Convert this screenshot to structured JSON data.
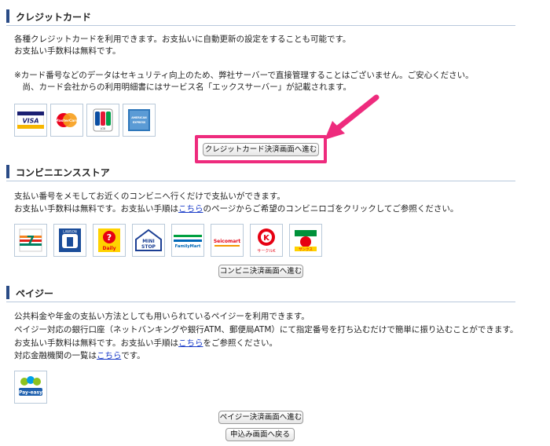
{
  "credit": {
    "heading": "クレジットカード",
    "lines": [
      "各種クレジットカードを利用できます。お支払いに自動更新の設定をすることも可能です。",
      "お支払い手数料は無料です。",
      "※カード番号などのデータはセキュリティ向上のため、弊社サーバーで直接管理することはございません。ご安心ください。",
      "　尚、カード会社からの利用明細書にはサービス名「エックスサーバー」が記載されます。"
    ],
    "logos": [
      "VISA",
      "MasterCard",
      "JCB",
      "AMERICAN EXPRESS"
    ],
    "button": "クレジットカード決済画面へ進む"
  },
  "convenience": {
    "heading": "コンビニエンスストア",
    "line1": "支払い番号をメモしてお近くのコンビニへ行くだけで支払いができます。",
    "line2_pre": "お支払い手数料は無料です。お支払い手順は",
    "line2_link": "こちら",
    "line2_post": "のページからご希望のコンビニロゴをクリックしてご参照ください。",
    "logos": [
      "7-ELEVEn",
      "LAWSON",
      "Daily",
      "MINI STOP",
      "FamilyMart",
      "Seicomart",
      "サークルK",
      "サンクス"
    ],
    "button": "コンビニ決済画面へ進む"
  },
  "payeasy": {
    "heading": "ペイジー",
    "line1": "公共料金や年金の支払い方法としても用いられているペイジーを利用できます。",
    "line2": "ペイジー対応の銀行口座（ネットバンキングや銀行ATM、郵便局ATM）にて指定番号を打ち込むだけで簡単に振り込むことができます。",
    "line3_pre": "お支払い手数料は無料です。お支払い手順は",
    "line3_link": "こちら",
    "line3_post": "をご参照ください。",
    "line4_pre": "対応金融機関の一覧は",
    "line4_link": "こちら",
    "line4_post": "です。",
    "logo": "Pay-easy",
    "button": "ペイジー決済画面へ進む",
    "back_button": "申込み画面へ戻る"
  },
  "colors": {
    "accent_bar": "#2a4b86",
    "highlight": "#ee2b7d",
    "link": "#1a3cc8"
  },
  "icons": [
    "visa-logo",
    "mastercard-logo",
    "jcb-logo",
    "amex-logo",
    "seven-eleven-logo",
    "lawson-logo",
    "daily-logo",
    "ministop-logo",
    "familymart-logo",
    "seicomart-logo",
    "circlek-logo",
    "sunkus-logo",
    "payeasy-logo",
    "pointer-arrow"
  ]
}
